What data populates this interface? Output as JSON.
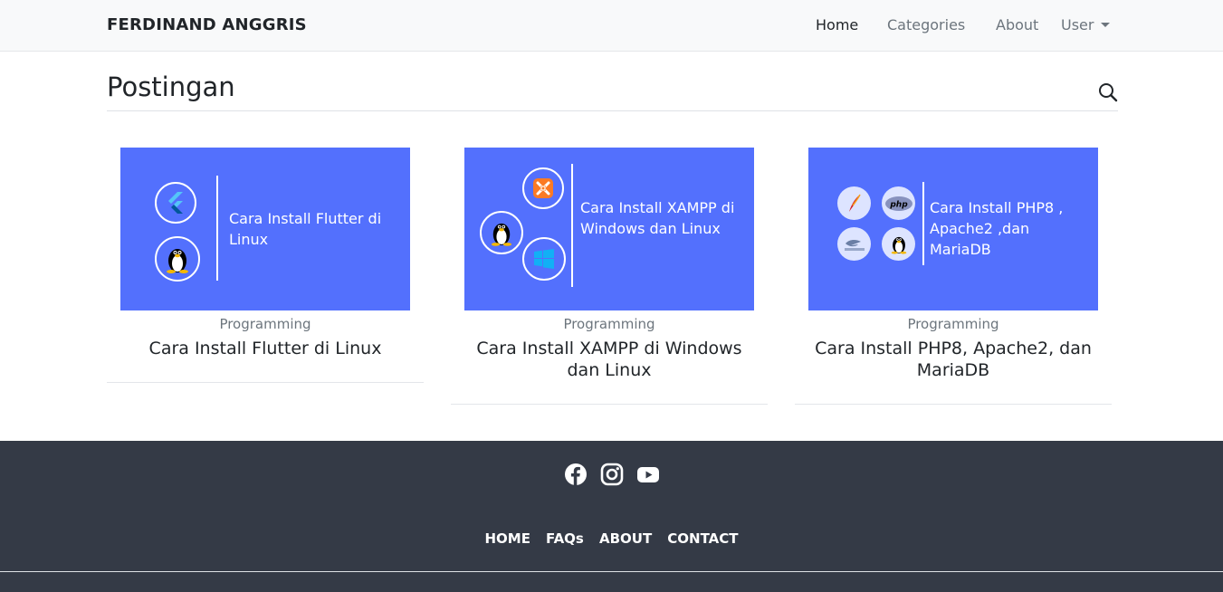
{
  "navbar": {
    "brand": "FERDINAND ANGGRIS",
    "items": [
      {
        "label": "Home",
        "active": true
      },
      {
        "label": "Categories"
      },
      {
        "label": "About"
      },
      {
        "label": "User"
      }
    ]
  },
  "page": {
    "title": "Postingan",
    "search_icon": "search-icon"
  },
  "posts": [
    {
      "thumb_text": "Cara Install Flutter di Linux",
      "thumb_icons": [
        "flutter-icon",
        "linux-tux-icon"
      ],
      "category": "Programming",
      "title": "Cara Install Flutter di Linux"
    },
    {
      "thumb_text": "Cara Install XAMPP di Windows dan Linux",
      "thumb_icons": [
        "xampp-icon",
        "linux-tux-icon",
        "windows-icon"
      ],
      "category": "Programming",
      "title": "Cara Install XAMPP di Windows dan Linux"
    },
    {
      "thumb_text": "Cara Install PHP8 , Apache2 ,dan MariaDB",
      "thumb_icons": [
        "apache-feather-icon",
        "php-icon",
        "mariadb-icon",
        "linux-tux-icon"
      ],
      "category": "Programming",
      "title": "Cara Install PHP8, Apache2, dan MariaDB"
    }
  ],
  "footer": {
    "social": [
      "facebook-icon",
      "instagram-icon",
      "youtube-icon"
    ],
    "links": [
      "HOME",
      "FAQs",
      "ABOUT",
      "CONTACT"
    ]
  },
  "colors": {
    "thumb_bg": "#5370fd",
    "footer_bg": "#343a46",
    "navbar_bg": "#f8f9fa"
  }
}
